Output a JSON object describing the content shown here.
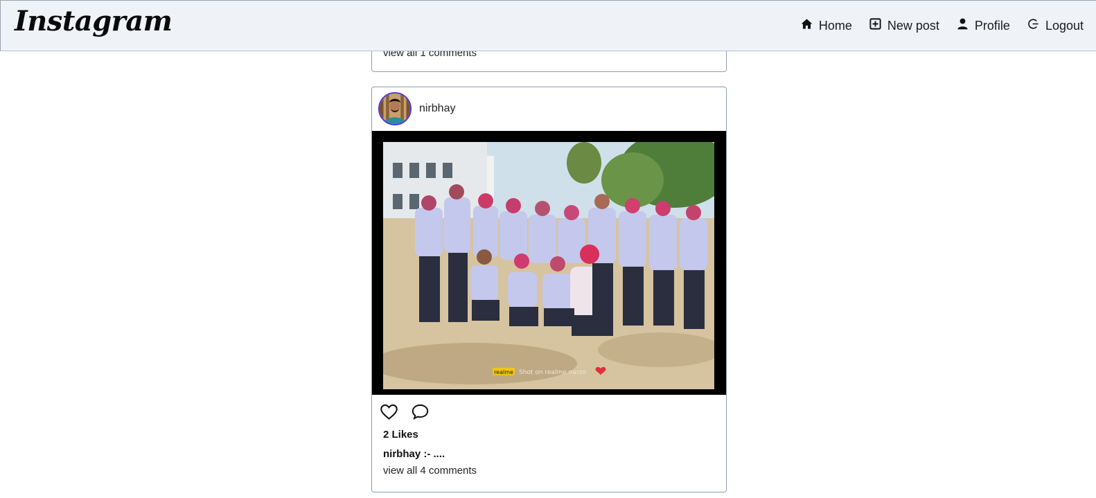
{
  "brand": {
    "logo": "Instagram"
  },
  "nav": {
    "items": [
      {
        "label": "Home",
        "icon": "home-icon"
      },
      {
        "label": "New post",
        "icon": "plus-square-icon"
      },
      {
        "label": "Profile",
        "icon": "user-icon"
      },
      {
        "label": "Logout",
        "icon": "logout-icon"
      }
    ]
  },
  "previous_post": {
    "comments_link": "view all 1 comments"
  },
  "post": {
    "username": "nirbhay",
    "avatar_icon": "avatar-image",
    "photo_watermark": "realme",
    "likes": "2 Likes",
    "caption": "nirbhay :- ....",
    "comments_link": "view all 4 comments"
  },
  "colors": {
    "navbar_bg": "#eff3f8",
    "card_border": "#8f9bb0",
    "avatar_ring": "#4a3fd6"
  }
}
